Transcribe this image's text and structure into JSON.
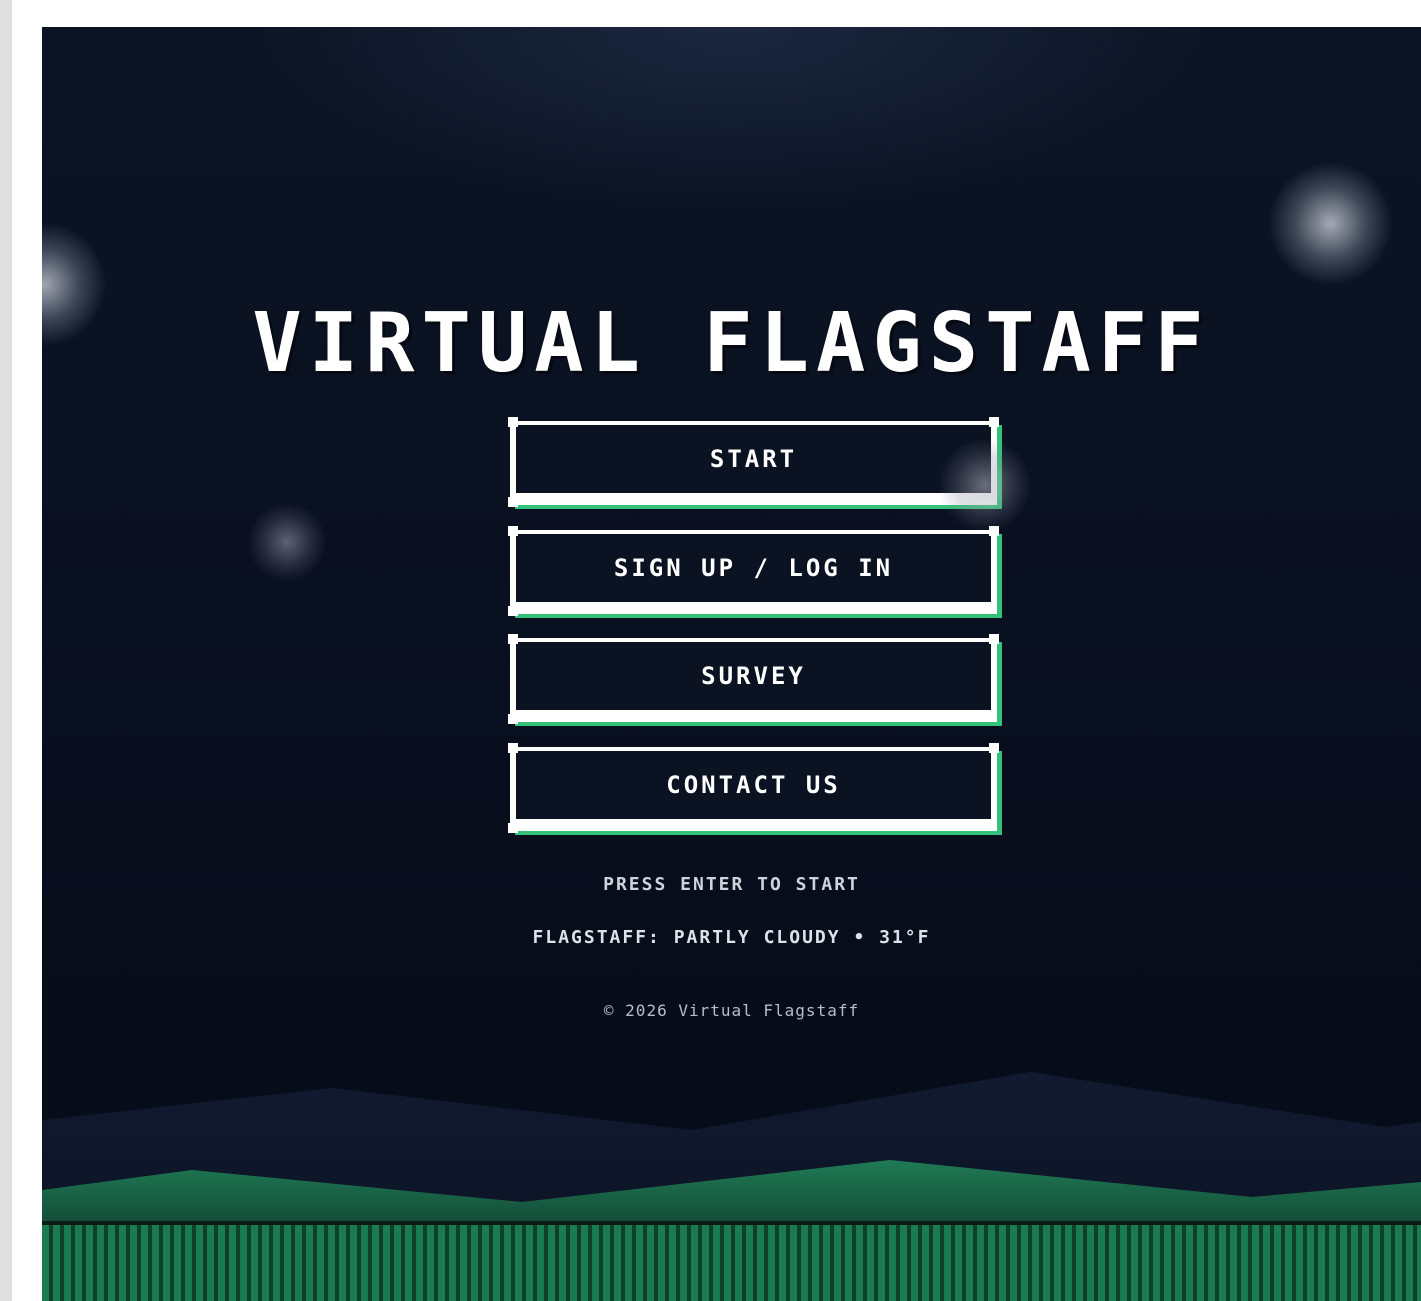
{
  "game": {
    "title": "VIRTUAL FLAGSTAFF"
  },
  "menu": {
    "items": [
      {
        "label": "START"
      },
      {
        "label": "SIGN UP / LOG IN"
      },
      {
        "label": "SURVEY"
      },
      {
        "label": "CONTACT US"
      }
    ]
  },
  "hints": {
    "press_enter": "PRESS ENTER TO START",
    "weather": "FLAGSTAFF: PARTLY CLOUDY • 31°F",
    "copyright": "© 2026 Virtual Flagstaff"
  },
  "colors": {
    "background": "#0a1121",
    "button_border": "#ffffff",
    "button_shadow": "#34c27a",
    "grass": "#1a7a50",
    "hills": "#1c6a4c"
  }
}
